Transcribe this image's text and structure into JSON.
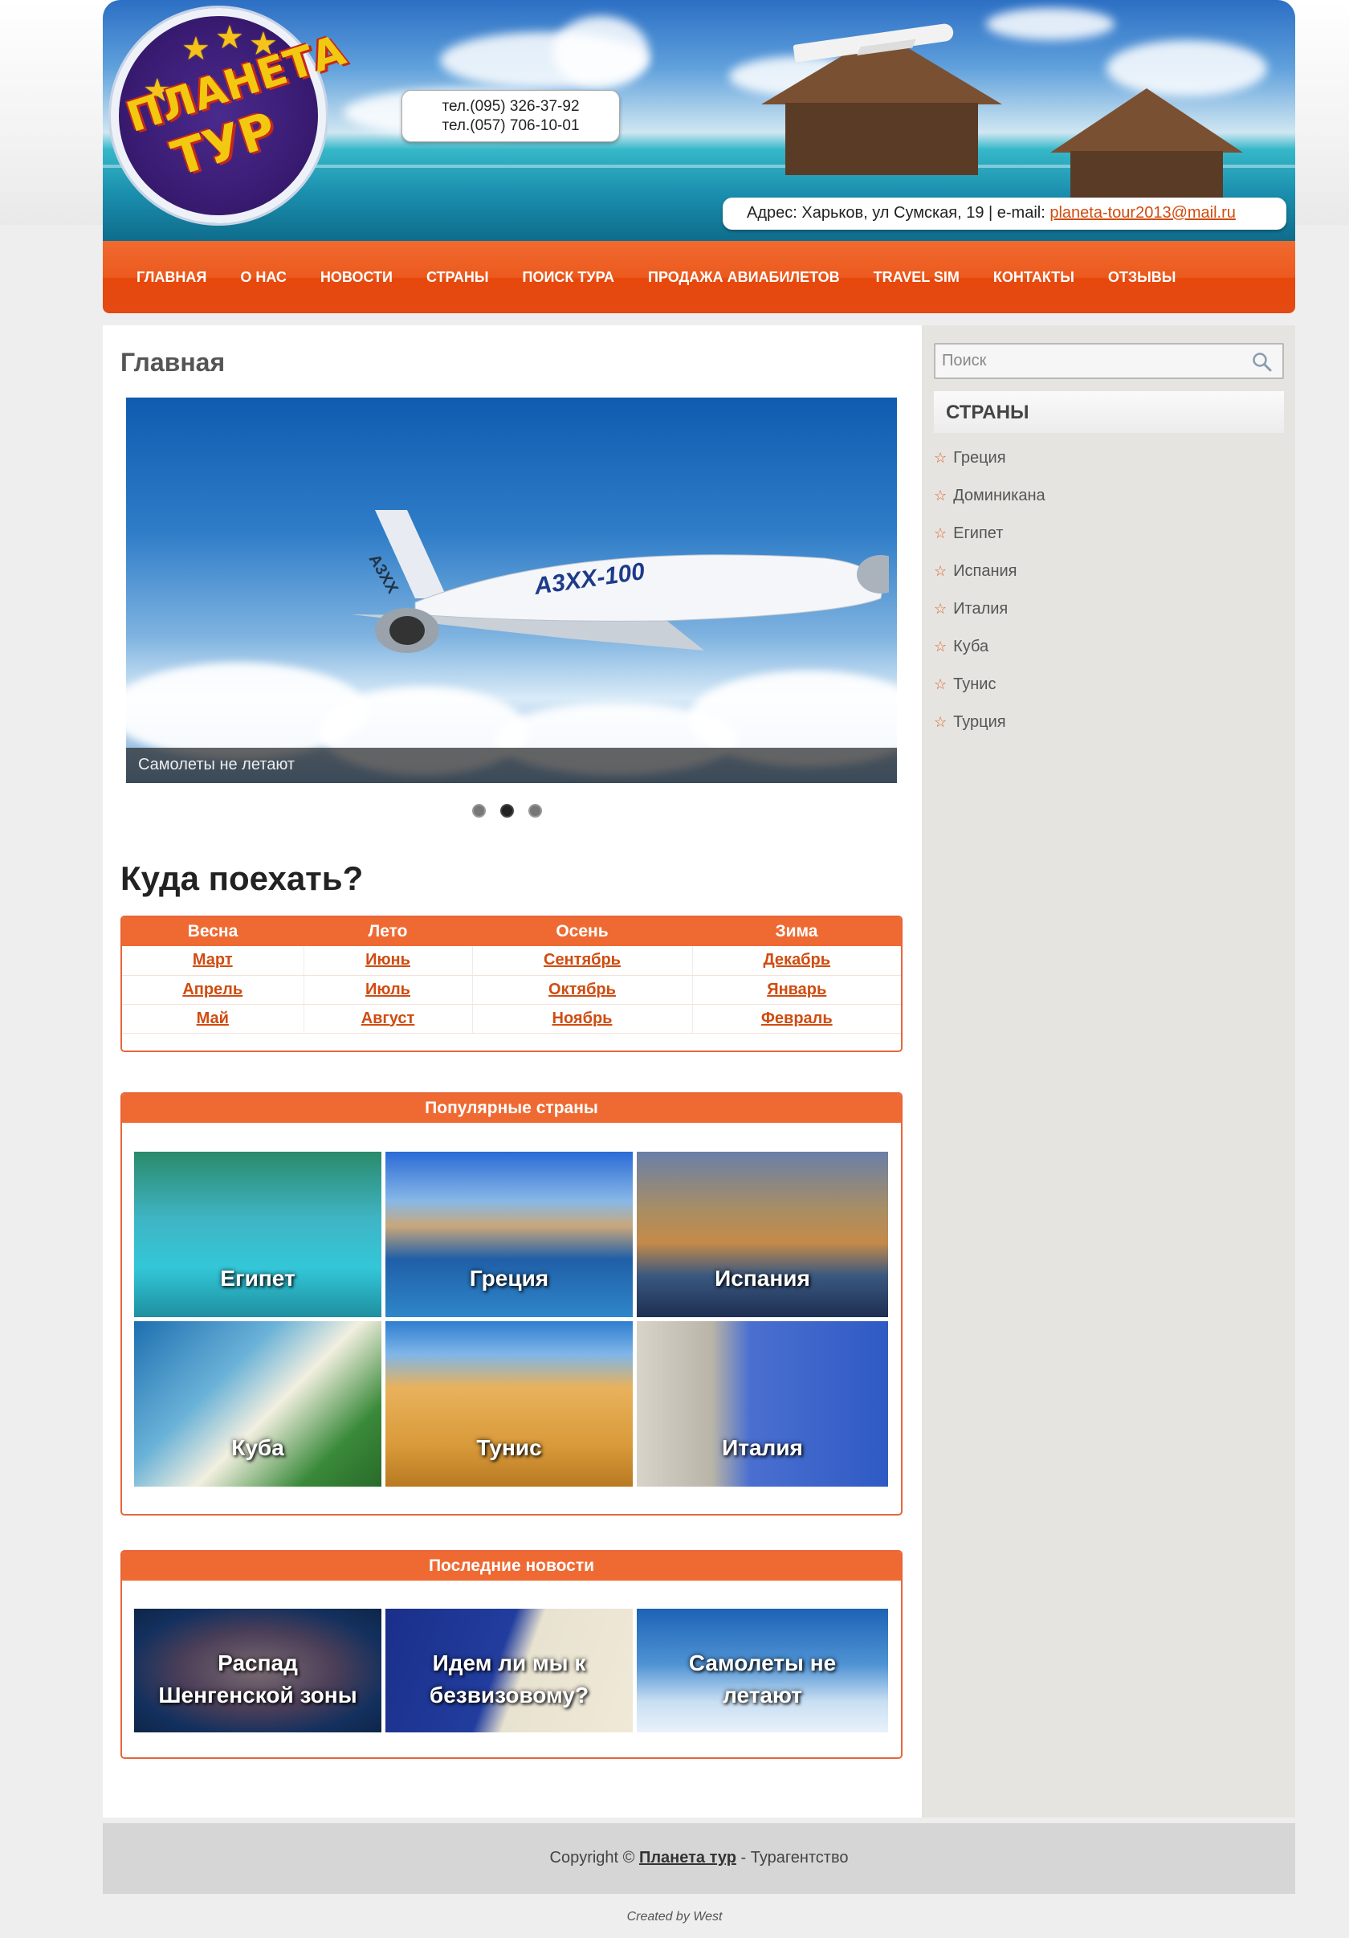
{
  "header": {
    "logo_line1": "ПЛАНЕТА",
    "logo_line2": "ТУР",
    "phones": [
      "тел.(095) 326-37-92",
      "тел.(057) 706-10-01"
    ],
    "address_text": "Адрес: Харьков, ул Сумская, 19 | e-mail: ",
    "email": "planeta-tour2013@mail.ru"
  },
  "nav": {
    "items": [
      "ГЛАВНАЯ",
      "О НАС",
      "НОВОСТИ",
      "СТРАНЫ",
      "ПОИСК ТУРА",
      "ПРОДАЖА АВИАБИЛЕТОВ",
      "TRAVEL SIM",
      "КОНТАКТЫ",
      "ОТЗЫВЫ"
    ]
  },
  "main": {
    "title": "Главная",
    "slider": {
      "plane_text": "A3XX-100",
      "caption": "Самолеты не летают",
      "dots": 3,
      "active_dot": 2
    },
    "where_title": "Куда поехать?",
    "seasons": {
      "headers": [
        "Весна",
        "Лето",
        "Осень",
        "Зима"
      ],
      "rows": [
        [
          "Март",
          "Июнь",
          "Сентябрь",
          "Декабрь"
        ],
        [
          "Апрель",
          "Июль",
          "Октябрь",
          "Январь"
        ],
        [
          "Май",
          "Август",
          "Ноябрь",
          "Февраль"
        ]
      ]
    },
    "popular": {
      "title": "Популярные страны",
      "tiles": [
        "Египет",
        "Греция",
        "Испания",
        "Куба",
        "Тунис",
        "Италия"
      ]
    },
    "news": {
      "title": "Последние новости",
      "tiles": [
        [
          "Распад",
          "Шенгенской зоны"
        ],
        [
          "Идем ли мы к",
          "безвизовому?"
        ],
        [
          "Самолеты не",
          "летают"
        ]
      ]
    }
  },
  "sidebar": {
    "search_placeholder": "Поиск",
    "countries_title": "СТРАНЫ",
    "countries": [
      "Греция",
      "Доминикана",
      "Египет",
      "Испания",
      "Италия",
      "Куба",
      "Тунис",
      "Турция"
    ]
  },
  "footer": {
    "copyright_prefix": "Copyright © ",
    "company": "Планета тур",
    "suffix": " - Турагентство",
    "credit": "Created by West"
  },
  "colors": {
    "accent": "#ef6a33",
    "link": "#d04c10"
  }
}
